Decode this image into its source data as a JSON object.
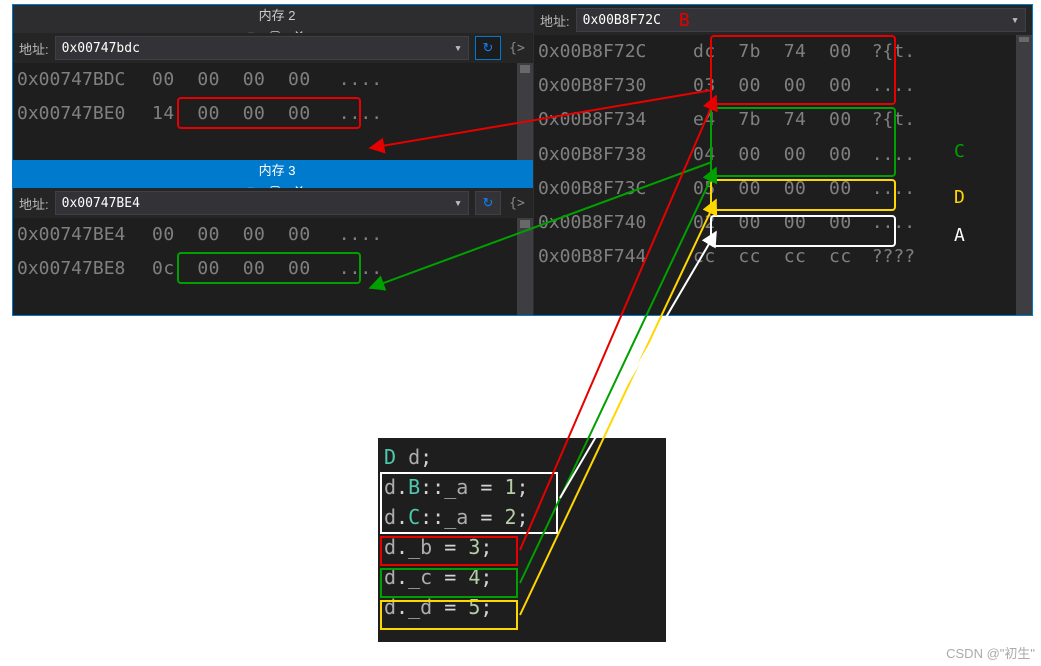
{
  "memory2": {
    "title": "内存 2",
    "addr_label": "地址:",
    "addr_value": "0x00747bdc",
    "rows": [
      {
        "addr": "0x00747BDC",
        "bytes": "00  00  00  00",
        "ascii": "...."
      },
      {
        "addr": "0x00747BE0",
        "bytes": "14  00  00  00",
        "ascii": "...."
      }
    ]
  },
  "memory3": {
    "title": "内存 3",
    "addr_label": "地址:",
    "addr_value": "0x00747BE4",
    "rows": [
      {
        "addr": "0x00747BE4",
        "bytes": "00  00  00  00",
        "ascii": "...."
      },
      {
        "addr": "0x00747BE8",
        "bytes": "0c  00  00  00",
        "ascii": "...."
      }
    ]
  },
  "memoryR": {
    "addr_label": "地址:",
    "addr_value": "0x00B8F72C",
    "rows": [
      {
        "addr": "0x00B8F72C",
        "bytes": "dc  7b  74  00",
        "ascii": "?{t."
      },
      {
        "addr": "0x00B8F730",
        "bytes": "03  00  00  00",
        "ascii": "...."
      },
      {
        "addr": "0x00B8F734",
        "bytes": "e4  7b  74  00",
        "ascii": "?{t."
      },
      {
        "addr": "0x00B8F738",
        "bytes": "04  00  00  00",
        "ascii": "...."
      },
      {
        "addr": "0x00B8F73C",
        "bytes": "05  00  00  00",
        "ascii": "...."
      },
      {
        "addr": "0x00B8F740",
        "bytes": "02  00  00  00",
        "ascii": "...."
      },
      {
        "addr": "0x00B8F744",
        "bytes": "cc  cc  cc  cc",
        "ascii": "????"
      }
    ]
  },
  "annotations": {
    "B": "B",
    "C": "C",
    "D": "D",
    "A": "A"
  },
  "code": {
    "l1": "D d;",
    "l2": "d.B::_a = 1;",
    "l3": "d.C::_a = 2;",
    "l4": "d._b = 3;",
    "l5": "d._c = 4;",
    "l6": "d._d = 5;"
  },
  "watermark": "CSDN @\"初生\""
}
